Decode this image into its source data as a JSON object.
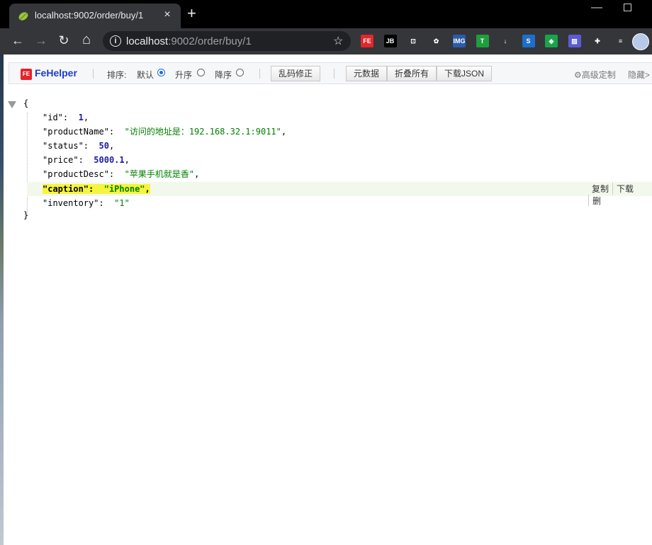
{
  "browser": {
    "tab_title": "localhost:9002/order/buy/1",
    "tab_close": "×",
    "new_tab": "+",
    "url_host": "localhost",
    "url_rest": ":9002/order/buy/1",
    "back": "←",
    "forward": "→",
    "reload": "↻",
    "home": "⌂",
    "star": "☆",
    "info": "i",
    "extensions": [
      {
        "icon": "fehelper-extension-icon",
        "text": "FE",
        "color": "#e2262b"
      },
      {
        "icon": "jetbrains-extension-icon",
        "text": "JB",
        "color": "#000000"
      },
      {
        "icon": "screenshot-extension-icon",
        "text": "⊡",
        "color": "#35363a"
      },
      {
        "icon": "octopus-extension-icon",
        "text": "✿",
        "color": "#35363a"
      },
      {
        "icon": "img-extension-icon",
        "text": "IMG",
        "color": "#2a5caa"
      },
      {
        "icon": "tampermonkey-extension-icon",
        "text": "T",
        "color": "#1e9e3e"
      },
      {
        "icon": "download-extension-icon",
        "text": "↓",
        "color": "#35363a"
      },
      {
        "icon": "s-extension-icon",
        "text": "S",
        "color": "#1e6fc8"
      },
      {
        "icon": "tag-extension-icon",
        "text": "◆",
        "color": "#19a34a"
      },
      {
        "icon": "stripes-extension-icon",
        "text": "▨",
        "color": "#5b5bd6"
      },
      {
        "icon": "puzzle-extension-icon",
        "text": "✚",
        "color": "#35363a"
      },
      {
        "icon": "playlist-extension-icon",
        "text": "≡",
        "color": "#35363a"
      }
    ]
  },
  "fehelper": {
    "name": "FeHelper",
    "logo": "FE",
    "sort_label": "排序:",
    "sort_default": "默认",
    "sort_asc": "升序",
    "sort_desc": "降序",
    "fix_encoding": "乱码修正",
    "raw_data": "元数据",
    "collapse_all": "折叠所有",
    "download_json": "下载JSON",
    "advanced": "⚙高级定制",
    "hide": "隐藏>",
    "selected_sort": "默认"
  },
  "json": {
    "open": "{",
    "close": "}",
    "rows": [
      {
        "key": "\"id\"",
        "colon": ":",
        "value": "1",
        "type": "number",
        "comma": ","
      },
      {
        "key": "\"productName\"",
        "colon": ":",
        "value": "\"访问的地址是：192.168.32.1:9011\"",
        "type": "string",
        "comma": ","
      },
      {
        "key": "\"status\"",
        "colon": ":",
        "value": "50",
        "type": "number",
        "comma": ","
      },
      {
        "key": "\"price\"",
        "colon": ":",
        "value": "5000.1",
        "type": "number",
        "comma": ","
      },
      {
        "key": "\"productDesc\"",
        "colon": ":",
        "value": "\"苹果手机就是香\"",
        "type": "string",
        "comma": ","
      },
      {
        "key": "\"caption\"",
        "colon": ":",
        "value": "\"iPhone\"",
        "type": "string",
        "comma": ","
      },
      {
        "key": "\"inventory\"",
        "colon": ":",
        "value": "\"1\"",
        "type": "string",
        "comma": ""
      }
    ],
    "row_actions": [
      "复制",
      "下载",
      "删"
    ]
  }
}
